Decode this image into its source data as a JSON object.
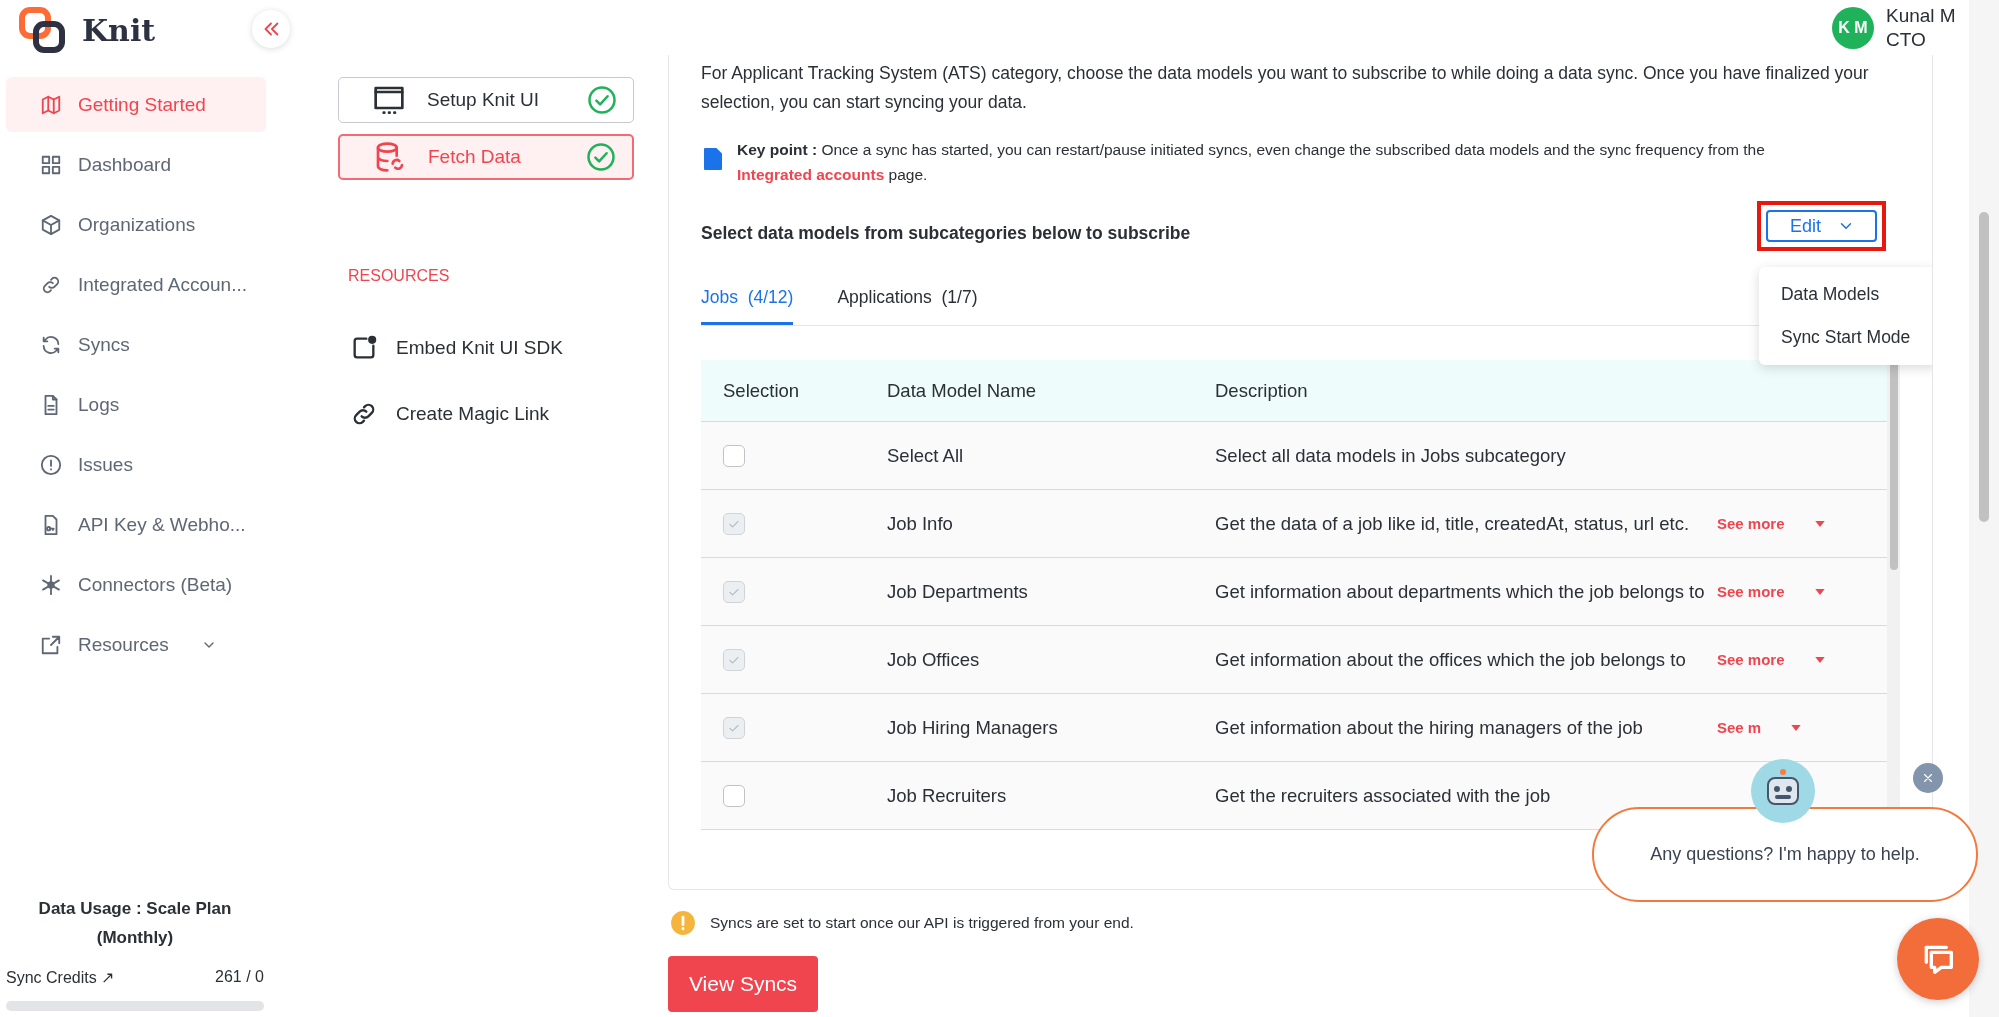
{
  "app": {
    "name": "Knit"
  },
  "sidebar": {
    "items": [
      {
        "label": "Getting Started",
        "kind": "link",
        "selected": true
      },
      {
        "label": "Dashboard",
        "kind": "link",
        "selected": false
      },
      {
        "label": "Organizations",
        "kind": "link",
        "selected": false
      },
      {
        "label": "Integrated Accoun...",
        "kind": "link",
        "selected": false
      },
      {
        "label": "Syncs",
        "kind": "link",
        "selected": false
      },
      {
        "label": "Logs",
        "kind": "link",
        "selected": false
      },
      {
        "label": "Issues",
        "kind": "link",
        "selected": false
      },
      {
        "label": "API Key & Webho...",
        "kind": "link",
        "selected": false
      },
      {
        "label": "Connectors (Beta)",
        "kind": "link",
        "selected": false
      },
      {
        "label": "Resources",
        "kind": "group",
        "selected": false,
        "expanded": false
      }
    ],
    "usage": {
      "title": "Data Usage : Scale Plan (Monthly)",
      "label": "Sync Credits ↗",
      "value": "261 / 0"
    }
  },
  "steps": [
    {
      "label": "Setup Knit UI",
      "done": true,
      "selected": false
    },
    {
      "label": "Fetch Data",
      "done": true,
      "selected": true
    }
  ],
  "resources": {
    "heading": "RESOURCES",
    "items": [
      "Embed Knit UI SDK",
      "Create Magic Link"
    ]
  },
  "user": {
    "initials": "K M",
    "name": "Kunal M",
    "role": "CTO"
  },
  "intro": "For Applicant Tracking System (ATS) category, choose the data models you want to subscribe to while doing a data sync. Once you have finalized your selection, you can start syncing your data.",
  "key_point": {
    "text": "**Key point :** Once a sync has started, you can restart/pause initiated syncs, even change the subscribed data models and the sync frequency from the",
    "link": "Integrated accounts",
    "after": "page."
  },
  "subscribe_heading": "Select data models from subcategories below to subscribe",
  "edit_menu": {
    "label": "Edit",
    "open": true,
    "items": [
      "Data Models",
      "Sync Start Mode"
    ]
  },
  "tabs": [
    {
      "label": "Jobs  (4/12)",
      "selected": true
    },
    {
      "label": "Applications  (1/7)",
      "selected": false
    }
  ],
  "table": {
    "columns": [
      "Selection",
      "Data Model Name",
      "Description"
    ],
    "rows": [
      {
        "name": "Select All",
        "description": "Select all data models in Jobs subcategory",
        "checked": false,
        "disabled": false
      },
      {
        "name": "Job Info",
        "description": "Get the data of a job like id, title, createdAt, status, url etc.",
        "checked": true,
        "disabled": true,
        "see_more": "See more"
      },
      {
        "name": "Job Departments",
        "description": "Get information about departments which the job belongs to",
        "checked": true,
        "disabled": true,
        "see_more": "See more"
      },
      {
        "name": "Job Offices",
        "description": "Get information about the offices which the job belongs to",
        "checked": true,
        "disabled": true,
        "see_more": "See more"
      },
      {
        "name": "Job Hiring Managers",
        "description": "Get information about the hiring managers of the job",
        "checked": true,
        "disabled": true,
        "see_more": "See m"
      },
      {
        "name": "Job Recruiters",
        "description": "Get the recruiters associated with the job",
        "checked": false,
        "disabled": false
      }
    ]
  },
  "notice": "Syncs are set to start once our API is triggered from your end.",
  "primary_button": "View Syncs",
  "chat": {
    "message": "Any questions? I'm happy to help."
  }
}
